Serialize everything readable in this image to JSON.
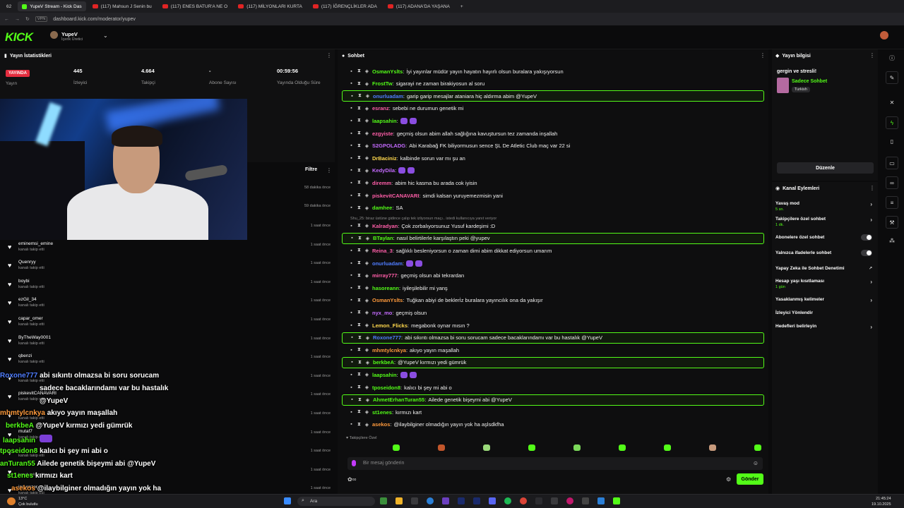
{
  "browser": {
    "tab_count": "62",
    "tabs": [
      {
        "label": "YupeV Stream - Kick Das"
      },
      {
        "label": "(117) Mahsun J Senin bu"
      },
      {
        "label": "(117) ENES BATUR'A NE O"
      },
      {
        "label": "(117) MİLYONLARI KURTA"
      },
      {
        "label": "(117) İĞRENÇLİKLER ADA"
      },
      {
        "label": "(117) ADANA'DA YAŞANA"
      }
    ],
    "url": "dashboard.kick.com/moderator/yupev",
    "url_badge": "VPN"
  },
  "header": {
    "logo": "KICK",
    "channel_name": "YupeV",
    "channel_role": "İçerik Üretici"
  },
  "stats": {
    "title": "Yayın İstatistikleri",
    "live_badge": "YAYINDA",
    "live_label": "Yayın",
    "viewers": "445",
    "viewers_label": "İzleyici",
    "followers": "4.664",
    "followers_label": "Takipçi",
    "subs": "-",
    "subs_label": "Abone Sayısı",
    "uptime": "00:59:56",
    "uptime_label": "Yayında Olduğu Süre"
  },
  "activity": {
    "filter": "Filtre",
    "times_top": [
      "58 dakika önce",
      "59 dakika önce"
    ],
    "items": [
      {
        "name": "",
        "sub": "",
        "time": "1 saat önce"
      },
      {
        "name": "eminemsi_emine",
        "sub": "kanalı takip etti",
        "time": "1 saat önce"
      },
      {
        "name": "Quenryy",
        "sub": "kanalı takip etti",
        "time": "1 saat önce"
      },
      {
        "name": "boybi",
        "sub": "kanalı takip etti",
        "time": "1 saat önce"
      },
      {
        "name": "ezGil_34",
        "sub": "kanalı takip etti",
        "time": "1 saat önce"
      },
      {
        "name": "capar_omer",
        "sub": "kanalı takip etti",
        "time": "1 saat önce"
      },
      {
        "name": "ByTheWay0001",
        "sub": "kanalı takip etti",
        "time": "1 saat önce"
      },
      {
        "name": "qbenzi",
        "sub": "kanalı takip etti",
        "time": "1 saat önce"
      },
      {
        "name": "",
        "sub": "kanalı takip etti",
        "time": "1 saat önce"
      },
      {
        "name": "piskevitCANAVARI",
        "sub": "kanalı takip etti",
        "time": "1 saat önce"
      },
      {
        "name": "",
        "sub": "kanalı takip etti",
        "time": "1 saat önce"
      },
      {
        "name": "mutaf7",
        "sub": "kanalı takip etti",
        "time": "1 saat önce"
      },
      {
        "name": "",
        "sub": "kanalı takip etti",
        "time": "1 saat önce"
      },
      {
        "name": "",
        "sub": "kanalı takip etti",
        "time": "1 saat önce"
      },
      {
        "name": "indurazer",
        "sub": "kanalı takip etti",
        "time": "1 saat önce"
      }
    ]
  },
  "overlay": [
    {
      "user": "Roxone777",
      "text": "abi sıkıntı olmazsa bi soru sorucam",
      "color": "#4f7dff"
    },
    {
      "user": "",
      "text": "sadece bacaklarındamı var bu hastalık",
      "color": "#fff"
    },
    {
      "user": "",
      "text": "@YupeV",
      "color": "#fff"
    },
    {
      "user": "mhmtylcnkya",
      "text": "akıyo yayın maşallah",
      "color": "#ff9a3c"
    },
    {
      "user": "berkbeA",
      "text": "@YupeV kırmızı yedi gümrük",
      "color": "#53fc18"
    },
    {
      "user": "laapsahin",
      "text": "",
      "color": "#53fc18"
    },
    {
      "user": "tposeidon8",
      "text": "kalıcı bi şey mi abi o",
      "color": "#53fc18"
    },
    {
      "user": "anTuran55",
      "text": "Ailede genetik bişeymi abi @YupeV",
      "color": "#53fc18"
    },
    {
      "user": "st1enes",
      "text": "kırmızı kart",
      "color": "#53fc18"
    },
    {
      "user": "asekos",
      "text": "@ilaybilginer olmadığın yayın yok ha",
      "color": "#ff9a3c"
    },
    {
      "user": "",
      "text": "aşlsdkfha",
      "color": "#fff"
    }
  ],
  "chat": {
    "title": "Sohbet",
    "messages": [
      {
        "user": "OsmanYslts",
        "text": "İyi yayınlar müdür yayın hayatın hayırlı olsun buralara yakışıyorsun",
        "color": "#53fc18",
        "hl": false
      },
      {
        "user": "FrostTw",
        "text": "sigarayi ne zaman birakiyosun al soru",
        "color": "#53fc18",
        "hl": false
      },
      {
        "user": "onurluadam",
        "text": "garip garip mesajlar ataniara hiç aldırma abim @YupeV",
        "color": "#4f7dff",
        "hl": true
      },
      {
        "user": "esranz",
        "text": "sebebi ne durumun genetik mi",
        "color": "#ff5ea8",
        "hl": false
      },
      {
        "user": "laapsahin",
        "text": "",
        "color": "#53fc18",
        "hl": false
      },
      {
        "user": "ezgyiste",
        "text": "geçmiş olsun abim allah sağlığına kavuştursun tez zamanda inşallah",
        "color": "#ff5ea8",
        "hl": false
      },
      {
        "user": "S2GPOLADG",
        "text": "Abi Karabağ FK biliyormusun sence ŞL De Atletic Club maç var 22 si",
        "color": "#c56bff",
        "hl": false
      },
      {
        "user": "DrBaciniz",
        "text": "kalbinde sorun var mı şu an",
        "color": "#ffd84d",
        "hl": false
      },
      {
        "user": "KedyDila",
        "text": "",
        "color": "#c56bff",
        "hl": false
      },
      {
        "user": "diremm",
        "text": "abim hic kasma bu arada cok iyisin",
        "color": "#ff5ea8",
        "hl": false
      },
      {
        "user": "piskevitCANAVARI",
        "text": "simdi kalsan yuruyemezmisin yani",
        "color": "#ff5ea8",
        "hl": false
      },
      {
        "user": "damhee",
        "text": "SA",
        "color": "#53fc18",
        "hl": false
      },
      {
        "user": "Kalradyan",
        "text": "Çok zorbalıyorsunuz Yusuf kardeşimi :D",
        "color": "#ff5ea8",
        "hl": false
      },
      {
        "user": "BTaylan",
        "text": "nasıl belirtilerle karşılaştın peki @yupev",
        "color": "#53fc18",
        "hl": true
      },
      {
        "user": "Reina_3",
        "text": "sağlıklı besleniyorsun o zaman dimi abim dikkat ediyorsun umarım",
        "color": "#ff5ea8",
        "hl": false
      },
      {
        "user": "onurluadam",
        "text": "",
        "color": "#4f7dff",
        "hl": false
      },
      {
        "user": "mirray777",
        "text": "geçmiş olsun abi tekrardan",
        "color": "#ff5ea8",
        "hl": false
      },
      {
        "user": "hasoreann",
        "text": "iyileşilebilir mi yanş",
        "color": "#53fc18",
        "hl": false
      },
      {
        "user": "OsmanYslts",
        "text": "Tuğkan abiyi de beklerİz buralara yayıncılık ona da yakışır",
        "color": "#ff9a3c",
        "hl": false
      },
      {
        "user": "nyx_mo",
        "text": "geçmiş olsun",
        "color": "#c56bff",
        "hl": false
      },
      {
        "user": "Lemon_Flicks",
        "text": "megabonk oynar mısın ?",
        "color": "#ffd84d",
        "hl": false
      },
      {
        "user": "Roxone777",
        "text": "abi sıkıntı olmazsa bi soru sorucam sadece bacaklarındamı var bu hastalık @YupeV",
        "color": "#4f7dff",
        "hl": true
      },
      {
        "user": "mhmtylcnkya",
        "text": "akıyo yayın maşallah",
        "color": "#ff9a3c",
        "hl": false
      },
      {
        "user": "berkbeA",
        "text": "@YupeV kırmızı yedi gümrük",
        "color": "#53fc18",
        "hl": true
      },
      {
        "user": "laapsahin",
        "text": "",
        "color": "#53fc18",
        "hl": false
      },
      {
        "user": "tposeidon8",
        "text": "kalıcı bi şey mi abi o",
        "color": "#53fc18",
        "hl": false
      },
      {
        "user": "AhmetErhanTuran55",
        "text": "Ailede genetik bişeymi abi @YupeV",
        "color": "#53fc18",
        "hl": true
      },
      {
        "user": "st1enes",
        "text": "kırmızı kart",
        "color": "#53fc18",
        "hl": false
      },
      {
        "user": "asekos",
        "text": "@ilaybilginer olmadığın yayın yok ha aşlsdkfha",
        "color": "#ff9a3c",
        "hl": false
      }
    ],
    "reply_context": "Shu_25: biraz üstüne gidince çalıp tek izliyorsun maçı.. istedi kullanıcıya yanıt veriyor",
    "followers_only": "Takipçilere Özel",
    "input_placeholder": "Bir mesaj gönderin",
    "send_label": "Gönder"
  },
  "info": {
    "title": "Yayın bilgisi",
    "stream_title": "gergin ve stresli!",
    "category": "Sadece Sohbet",
    "language": "Turkish",
    "edit_label": "Düzenle"
  },
  "actions": {
    "title": "Kanal Eylemleri",
    "rows": [
      {
        "label": "Yavaş mod",
        "sub": "5 sn.",
        "kind": "arrow"
      },
      {
        "label": "Takipçilere özel sohbet",
        "sub": "1 dk.",
        "kind": "arrow"
      },
      {
        "label": "Abonelere özel sohbet",
        "sub": "",
        "kind": "toggle"
      },
      {
        "label": "Yalnızca ifadelerle sohbet",
        "sub": "",
        "kind": "toggle"
      },
      {
        "label": "Yapay Zeka ile Sohbet Denetimi",
        "sub": "",
        "kind": "ext"
      },
      {
        "label": "Hesap yaşı kısıtlaması",
        "sub": "1 gün",
        "kind": "arrow"
      },
      {
        "label": "Yasaklanmış kelimeler",
        "sub": "",
        "kind": "arrow"
      },
      {
        "label": "İzleyici Yönlendir",
        "sub": "",
        "kind": "none"
      },
      {
        "label": "Hedefleri belirleyin",
        "sub": "",
        "kind": "arrow"
      }
    ]
  },
  "taskbar": {
    "search": "Ara",
    "weather_temp": "13°C",
    "weather_desc": "Çok bulutlu",
    "time": "21:45:24",
    "date": "19.10.2025"
  }
}
